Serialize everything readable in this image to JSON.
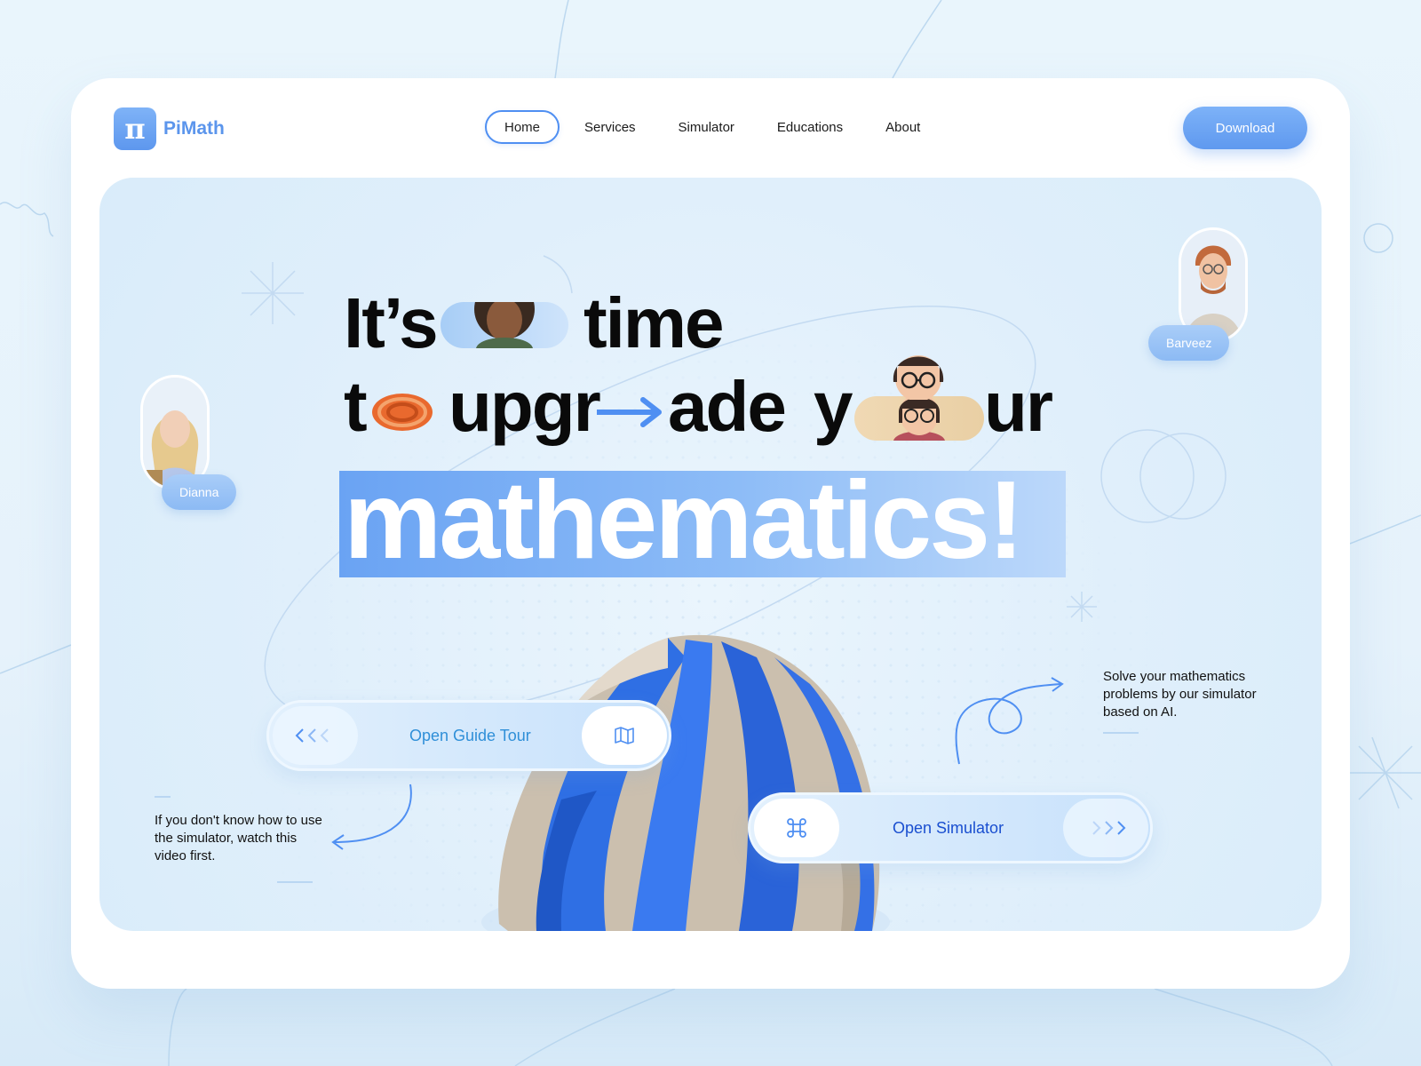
{
  "brand": {
    "name": "PiMath",
    "logo_glyph": "π",
    "color": "#5b95ec"
  },
  "nav": {
    "items": [
      {
        "label": "Home",
        "active": true
      },
      {
        "label": "Services",
        "active": false
      },
      {
        "label": "Simulator",
        "active": false
      },
      {
        "label": "Educations",
        "active": false
      },
      {
        "label": "About",
        "active": false
      }
    ]
  },
  "header": {
    "download_label": "Download"
  },
  "hero": {
    "line1": {
      "word1": "It’s",
      "word2": "time"
    },
    "line2": {
      "word1": "t",
      "word2": "upgr",
      "word3": "ade",
      "word4": "y",
      "word5": "ur"
    },
    "big_word": "mathematics!",
    "profiles": [
      {
        "name": "Dianna",
        "icon": "woman-portrait-icon"
      },
      {
        "name": "Barveez",
        "icon": "man-portrait-icon"
      }
    ],
    "guide_tour": {
      "label": "Open Guide Tour",
      "icon": "map-icon"
    },
    "simulator": {
      "label": "Open Simulator",
      "icon": "command-icon"
    },
    "left_note": "If you don't know how to use the simulator, watch this video first.",
    "right_note": "Solve your mathematics problems by our simulator based on AI."
  },
  "colors": {
    "accent": "#5b95ec",
    "hero_bg": "#e0effb",
    "sculpture_blue": "#2f6fe4",
    "sculpture_beige": "#cbbfae"
  }
}
